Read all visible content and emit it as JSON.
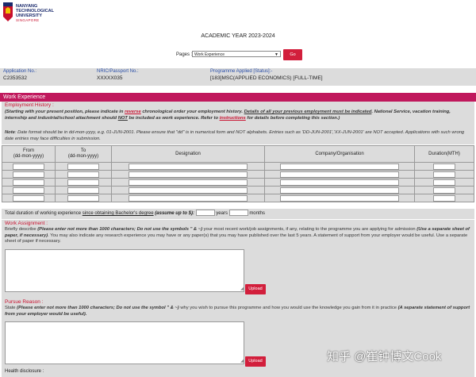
{
  "logo": {
    "line1": "NANYANG",
    "line2": "TECHNOLOGICAL",
    "line3": "UNIVERSITY",
    "line4": "SINGAPORE"
  },
  "academic_year": "ACADEMIC YEAR 2023-2024",
  "pages": {
    "label": "Pages :",
    "selected": "Work Experience",
    "go_label": "Go"
  },
  "applicant": {
    "app_no_label": "Application No.:",
    "app_no": "C2353532",
    "nric_label": "NRIC/Passport No.:",
    "nric": "XXXXX035",
    "programme_label": "Programme Applied [Status]:-",
    "programme": "[183]MSC(APPLIED ECONOMICS) [FULL-TIME]"
  },
  "section_title": "Work Experience",
  "employment": {
    "title": "Employment History :",
    "i1": "(Starting with your present position, please indicate in ",
    "i2": "reverse",
    "i3": " chronological order your employment history. ",
    "i4": "Details of all your previous employment must be indicated",
    "i5": ". National Service, vacation training, internship and industrial/school attachment should ",
    "i6": "NOT",
    "i7": " be included as work experience. Refer to ",
    "i8": "instructions",
    "i9": " for details before completing this section.)",
    "n1": "Note",
    "n2": ": Date format should be in dd-mon-yyyy, e.g. 01-JUN-2001. Please ensure that \"dd\" is in numerical form and NOT alphabets. Entries such as 'DD-JUN-2001','XX-JUN-2001' are NOT accepted. Applications with such wrong date entries may face difficulties in submission."
  },
  "table": {
    "from_label": "From",
    "to_label": "To",
    "date_fmt": "(dd-mon-yyyy)",
    "designation": "Designation",
    "company": "Company/Organisation",
    "duration": "Duration(MTH)",
    "rows": 5
  },
  "total_duration": {
    "t1": "Total duration of working experience ",
    "t2": "since obtaining Bachelor's degree",
    "t3": " (assume up to $): ",
    "years": "years",
    "months": "months"
  },
  "work_assignment": {
    "title": "Work Assignment :",
    "d1": "Briefly describe ",
    "d2": "(Please enter not more than 1000 characters; Do not use the symbols \" & ~)",
    "d3": " your most recent work/job assignments, if any, relating to the programme you are applying for admission ",
    "d4": "(Use a separate sheet of paper, if necessary)",
    "d5": ". You may also indicate any research experience you may have or any paper(s) that you may have published over the last 5 years. A statement of support from your employer would be useful. Use a separate sheet of paper if necessary.",
    "upload": "Upload"
  },
  "pursue_reason": {
    "title": "Pursue Reason :",
    "d1": "State ",
    "d2": "(Please enter not more than 1000 characters; Do not use the symbol \" & ~)",
    "d3": " why you wish to pursue this programme and how you would use the knowledge you gain from it in practice ",
    "d4": "(A separate statement of support from your employer would be useful).",
    "upload": "Upload"
  },
  "health": {
    "title": "Health disclosure :"
  },
  "watermark": "知乎 @崔钟博文Cook",
  "colors": {
    "accent": "#c0185c",
    "button": "#d21f3c",
    "label_blue": "#2a4fa8"
  }
}
